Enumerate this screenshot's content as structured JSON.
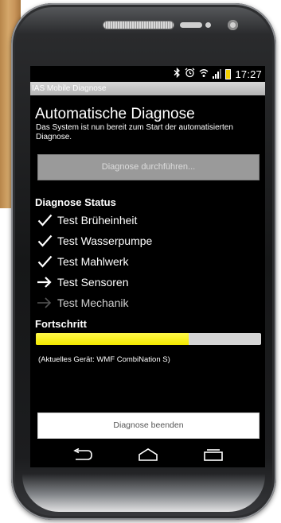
{
  "status_bar": {
    "time": "17:27",
    "icons": [
      "bluetooth-icon",
      "alarm-icon",
      "wifi-icon",
      "signal-icon",
      "battery-icon"
    ]
  },
  "app": {
    "title": "IAS Mobile Diagnose"
  },
  "main": {
    "heading": "Automatische Diagnose",
    "intro": "Das System ist nun bereit zum Start der automatisierten Diagnose.",
    "start_button": "Diagnose durchführen...",
    "status_heading": "Diagnose Status",
    "tests": [
      {
        "label": "Test Brüheinheit",
        "state": "done",
        "icon": "checkmark-icon"
      },
      {
        "label": "Test Wasserpumpe",
        "state": "done",
        "icon": "checkmark-icon"
      },
      {
        "label": "Test Mahlwerk",
        "state": "done",
        "icon": "checkmark-icon"
      },
      {
        "label": "Test Sensoren",
        "state": "running",
        "icon": "arrow-right-icon"
      },
      {
        "label": "Test Mechanik",
        "state": "pending",
        "icon": "arrow-right-dim-icon"
      }
    ],
    "progress_heading": "Fortschritt",
    "progress_value": 0.68,
    "device_text": "(Aktuelles Gerät: WMF CombiNation S)",
    "finish_button": "Diagnose beenden"
  },
  "navbar": {
    "buttons": [
      "back-icon",
      "home-icon",
      "recent-apps-icon"
    ]
  },
  "colors": {
    "progress_fill": "#f3e800",
    "progress_track": "#d5d5d5",
    "battery": "#f2d000"
  }
}
